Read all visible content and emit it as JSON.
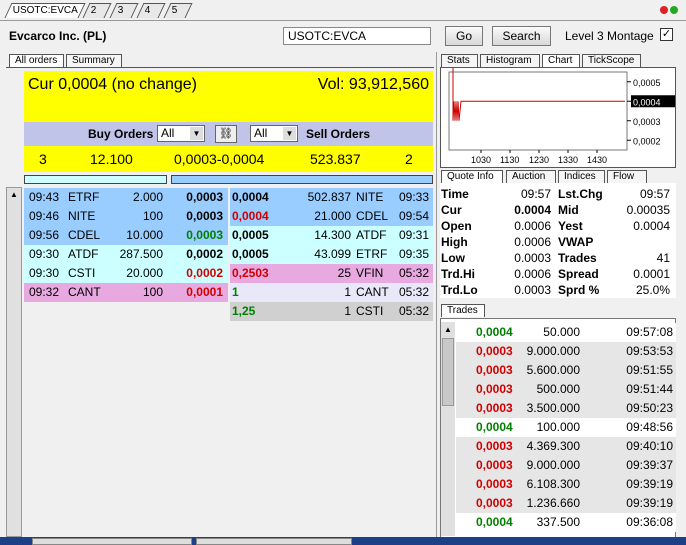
{
  "tabs": [
    "USOTC:EVCA",
    "2",
    "3",
    "4",
    "5"
  ],
  "header": {
    "company": "Evcarco Inc. (PL)",
    "symbol_value": "USOTC:EVCA",
    "go_label": "Go",
    "search_label": "Search",
    "montage_label": "Level 3 Montage",
    "montage_check": "✓"
  },
  "left_tabs": [
    "All orders",
    "Summary"
  ],
  "summary": {
    "cur": "Cur 0,0004 (no change)",
    "vol": "Vol: 93,912,560"
  },
  "orders_header": {
    "buy_label": "Buy Orders",
    "buy_filter": "All",
    "sell_filter": "All",
    "sell_label": "Sell Orders"
  },
  "totals": {
    "buy_count": "3",
    "buy_volume": "12.100",
    "spread": "0,0003-0,0004",
    "sell_volume": "523.837",
    "sell_count": "2"
  },
  "buy_orders": [
    {
      "time": "09:43",
      "mm": "ETRF",
      "size": "2.000",
      "price": "0,0003",
      "bg": "#99ccff",
      "color": "#000000"
    },
    {
      "time": "09:46",
      "mm": "NITE",
      "size": "100",
      "price": "0,0003",
      "bg": "#99ccff",
      "color": "#000000"
    },
    {
      "time": "09:56",
      "mm": "CDEL",
      "size": "10.000",
      "price": "0,0003",
      "bg": "#99ccff",
      "color": "#008000"
    },
    {
      "time": "09:30",
      "mm": "ATDF",
      "size": "287.500",
      "price": "0,0002",
      "bg": "#ccffff",
      "color": "#000000"
    },
    {
      "time": "09:30",
      "mm": "CSTI",
      "size": "20.000",
      "price": "0,0002",
      "bg": "#ccffff",
      "color": "#d00000"
    },
    {
      "time": "09:32",
      "mm": "CANT",
      "size": "100",
      "price": "0,0001",
      "bg": "#e8a8e0",
      "color": "#d00000"
    }
  ],
  "sell_orders": [
    {
      "price": "0,0004",
      "size": "502.837",
      "mm": "NITE",
      "time": "09:33",
      "bg": "#99ccff",
      "color": "#000000"
    },
    {
      "price": "0,0004",
      "size": "21.000",
      "mm": "CDEL",
      "time": "09:54",
      "bg": "#99ccff",
      "color": "#d00000"
    },
    {
      "price": "0,0005",
      "size": "14.300",
      "mm": "ATDF",
      "time": "09:31",
      "bg": "#ccffff",
      "color": "#000000"
    },
    {
      "price": "0,0005",
      "size": "43.099",
      "mm": "ETRF",
      "time": "09:35",
      "bg": "#ccffff",
      "color": "#000000"
    },
    {
      "price": "0,2503",
      "size": "25",
      "mm": "VFIN",
      "time": "05:32",
      "bg": "#e8a8e0",
      "color": "#d00000"
    },
    {
      "price": "1",
      "size": "1",
      "mm": "CANT",
      "time": "05:32",
      "bg": "#e8e8f8",
      "color": "#008000"
    },
    {
      "price": "1,25",
      "size": "1",
      "mm": "CSTI",
      "time": "05:32",
      "bg": "#d0d0d0",
      "color": "#008000"
    }
  ],
  "right_tabs": [
    "Stats",
    "Histogram",
    "Chart",
    "TickScope"
  ],
  "chart_data": {
    "type": "line",
    "x_ticks": [
      "1030",
      "1130",
      "1230",
      "1330",
      "1430"
    ],
    "y_ticks": [
      "0,0005",
      "0,0004",
      "0,0003",
      "0,0002"
    ],
    "current": "0,0004",
    "line_color": "#cc0000"
  },
  "quote_tabs": [
    "Quote Info",
    "Auction",
    "Indices",
    "Flow"
  ],
  "quote": [
    {
      "l1": "Time",
      "v1": "09:57",
      "l2": "Lst.Chg",
      "v2": "09:57"
    },
    {
      "l1": "Cur",
      "v1": "0.0004",
      "l2": "Mid",
      "v2": "0.00035"
    },
    {
      "l1": "Open",
      "v1": "0.0006",
      "l2": "Yest",
      "v2": "0.0004"
    },
    {
      "l1": "High",
      "v1": "0.0006",
      "l2": "VWAP",
      "v2": ""
    },
    {
      "l1": "Low",
      "v1": "0.0003",
      "l2": "Trades",
      "v2": "41"
    },
    {
      "l1": "Trd.Hi",
      "v1": "0.0006",
      "l2": "Spread",
      "v2": "0.0001"
    },
    {
      "l1": "Trd.Lo",
      "v1": "0.0003",
      "l2": "Sprd %",
      "v2": "25.0%"
    }
  ],
  "trades_tab": "Trades",
  "trades": [
    {
      "price": "0,0004",
      "size": "50.000",
      "time": "09:57:08",
      "color": "#008000",
      "bg": "#ffffff"
    },
    {
      "price": "0,0003",
      "size": "9.000.000",
      "time": "09:53:53",
      "color": "#d00000",
      "bg": "#e6e6e6"
    },
    {
      "price": "0,0003",
      "size": "5.600.000",
      "time": "09:51:55",
      "color": "#d00000",
      "bg": "#e6e6e6"
    },
    {
      "price": "0,0003",
      "size": "500.000",
      "time": "09:51:44",
      "color": "#d00000",
      "bg": "#e6e6e6"
    },
    {
      "price": "0,0003",
      "size": "3.500.000",
      "time": "09:50:23",
      "color": "#d00000",
      "bg": "#e6e6e6"
    },
    {
      "price": "0,0004",
      "size": "100.000",
      "time": "09:48:56",
      "color": "#008000",
      "bg": "#ffffff"
    },
    {
      "price": "0,0003",
      "size": "4.369.300",
      "time": "09:40:10",
      "color": "#d00000",
      "bg": "#e6e6e6"
    },
    {
      "price": "0,0003",
      "size": "9.000.000",
      "time": "09:39:37",
      "color": "#d00000",
      "bg": "#e6e6e6"
    },
    {
      "price": "0,0003",
      "size": "6.108.300",
      "time": "09:39:19",
      "color": "#d00000",
      "bg": "#e6e6e6"
    },
    {
      "price": "0,0003",
      "size": "1.236.660",
      "time": "09:39:19",
      "color": "#d00000",
      "bg": "#e6e6e6"
    },
    {
      "price": "0,0004",
      "size": "337.500",
      "time": "09:36:08",
      "color": "#008000",
      "bg": "#ffffff"
    }
  ]
}
